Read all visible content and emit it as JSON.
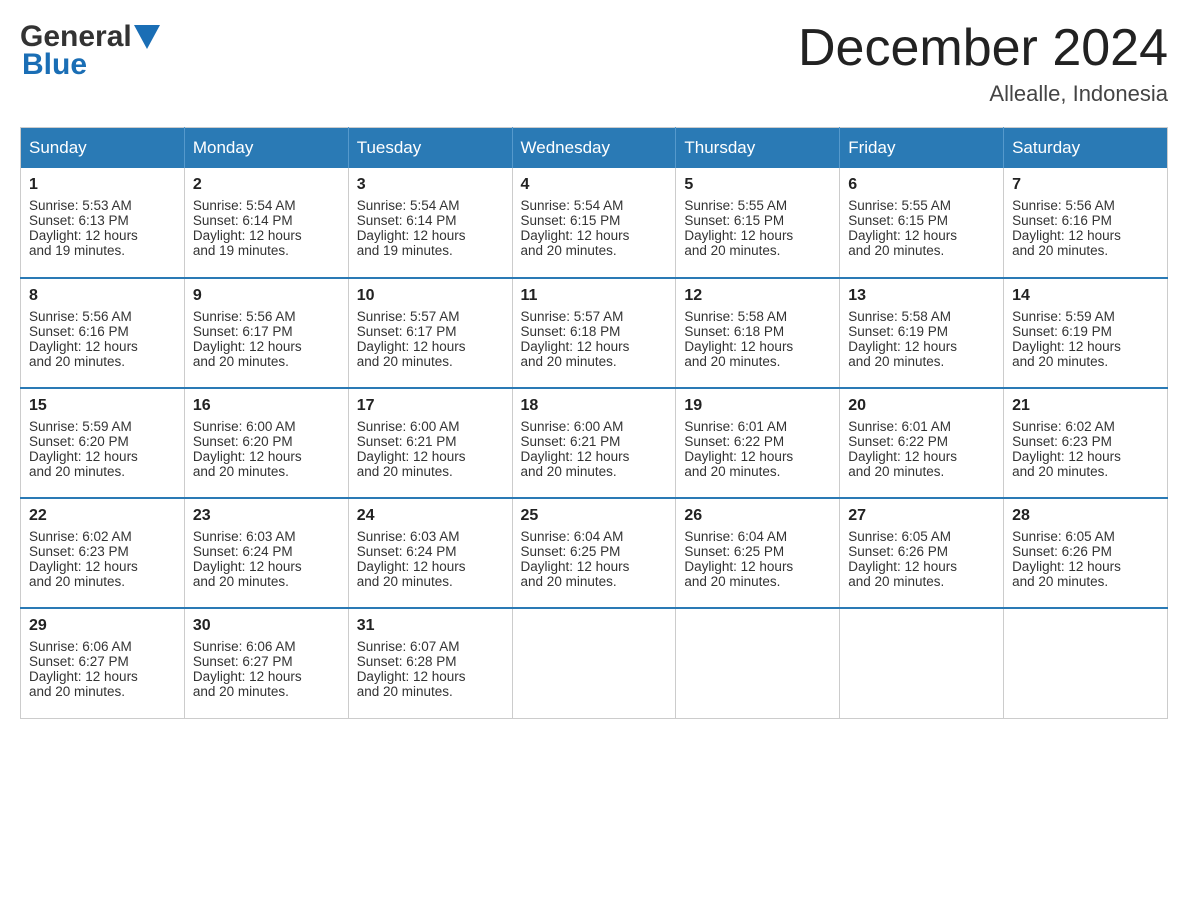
{
  "header": {
    "logo_general": "General",
    "logo_blue": "Blue",
    "month_title": "December 2024",
    "location": "Allealle, Indonesia"
  },
  "columns": [
    "Sunday",
    "Monday",
    "Tuesday",
    "Wednesday",
    "Thursday",
    "Friday",
    "Saturday"
  ],
  "weeks": [
    [
      {
        "day": "1",
        "sunrise": "5:53 AM",
        "sunset": "6:13 PM",
        "daylight": "12 hours and 19 minutes."
      },
      {
        "day": "2",
        "sunrise": "5:54 AM",
        "sunset": "6:14 PM",
        "daylight": "12 hours and 19 minutes."
      },
      {
        "day": "3",
        "sunrise": "5:54 AM",
        "sunset": "6:14 PM",
        "daylight": "12 hours and 19 minutes."
      },
      {
        "day": "4",
        "sunrise": "5:54 AM",
        "sunset": "6:15 PM",
        "daylight": "12 hours and 20 minutes."
      },
      {
        "day": "5",
        "sunrise": "5:55 AM",
        "sunset": "6:15 PM",
        "daylight": "12 hours and 20 minutes."
      },
      {
        "day": "6",
        "sunrise": "5:55 AM",
        "sunset": "6:15 PM",
        "daylight": "12 hours and 20 minutes."
      },
      {
        "day": "7",
        "sunrise": "5:56 AM",
        "sunset": "6:16 PM",
        "daylight": "12 hours and 20 minutes."
      }
    ],
    [
      {
        "day": "8",
        "sunrise": "5:56 AM",
        "sunset": "6:16 PM",
        "daylight": "12 hours and 20 minutes."
      },
      {
        "day": "9",
        "sunrise": "5:56 AM",
        "sunset": "6:17 PM",
        "daylight": "12 hours and 20 minutes."
      },
      {
        "day": "10",
        "sunrise": "5:57 AM",
        "sunset": "6:17 PM",
        "daylight": "12 hours and 20 minutes."
      },
      {
        "day": "11",
        "sunrise": "5:57 AM",
        "sunset": "6:18 PM",
        "daylight": "12 hours and 20 minutes."
      },
      {
        "day": "12",
        "sunrise": "5:58 AM",
        "sunset": "6:18 PM",
        "daylight": "12 hours and 20 minutes."
      },
      {
        "day": "13",
        "sunrise": "5:58 AM",
        "sunset": "6:19 PM",
        "daylight": "12 hours and 20 minutes."
      },
      {
        "day": "14",
        "sunrise": "5:59 AM",
        "sunset": "6:19 PM",
        "daylight": "12 hours and 20 minutes."
      }
    ],
    [
      {
        "day": "15",
        "sunrise": "5:59 AM",
        "sunset": "6:20 PM",
        "daylight": "12 hours and 20 minutes."
      },
      {
        "day": "16",
        "sunrise": "6:00 AM",
        "sunset": "6:20 PM",
        "daylight": "12 hours and 20 minutes."
      },
      {
        "day": "17",
        "sunrise": "6:00 AM",
        "sunset": "6:21 PM",
        "daylight": "12 hours and 20 minutes."
      },
      {
        "day": "18",
        "sunrise": "6:00 AM",
        "sunset": "6:21 PM",
        "daylight": "12 hours and 20 minutes."
      },
      {
        "day": "19",
        "sunrise": "6:01 AM",
        "sunset": "6:22 PM",
        "daylight": "12 hours and 20 minutes."
      },
      {
        "day": "20",
        "sunrise": "6:01 AM",
        "sunset": "6:22 PM",
        "daylight": "12 hours and 20 minutes."
      },
      {
        "day": "21",
        "sunrise": "6:02 AM",
        "sunset": "6:23 PM",
        "daylight": "12 hours and 20 minutes."
      }
    ],
    [
      {
        "day": "22",
        "sunrise": "6:02 AM",
        "sunset": "6:23 PM",
        "daylight": "12 hours and 20 minutes."
      },
      {
        "day": "23",
        "sunrise": "6:03 AM",
        "sunset": "6:24 PM",
        "daylight": "12 hours and 20 minutes."
      },
      {
        "day": "24",
        "sunrise": "6:03 AM",
        "sunset": "6:24 PM",
        "daylight": "12 hours and 20 minutes."
      },
      {
        "day": "25",
        "sunrise": "6:04 AM",
        "sunset": "6:25 PM",
        "daylight": "12 hours and 20 minutes."
      },
      {
        "day": "26",
        "sunrise": "6:04 AM",
        "sunset": "6:25 PM",
        "daylight": "12 hours and 20 minutes."
      },
      {
        "day": "27",
        "sunrise": "6:05 AM",
        "sunset": "6:26 PM",
        "daylight": "12 hours and 20 minutes."
      },
      {
        "day": "28",
        "sunrise": "6:05 AM",
        "sunset": "6:26 PM",
        "daylight": "12 hours and 20 minutes."
      }
    ],
    [
      {
        "day": "29",
        "sunrise": "6:06 AM",
        "sunset": "6:27 PM",
        "daylight": "12 hours and 20 minutes."
      },
      {
        "day": "30",
        "sunrise": "6:06 AM",
        "sunset": "6:27 PM",
        "daylight": "12 hours and 20 minutes."
      },
      {
        "day": "31",
        "sunrise": "6:07 AM",
        "sunset": "6:28 PM",
        "daylight": "12 hours and 20 minutes."
      },
      null,
      null,
      null,
      null
    ]
  ],
  "labels": {
    "sunrise": "Sunrise:",
    "sunset": "Sunset:",
    "daylight": "Daylight:"
  }
}
